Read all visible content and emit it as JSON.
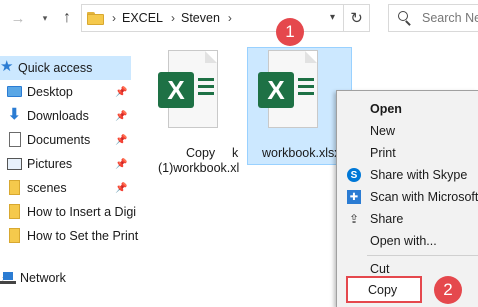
{
  "address_bar": {
    "crumbs": [
      "EXCEL",
      "Steven"
    ],
    "separator": "›",
    "search_placeholder": "Search Ne"
  },
  "nav_pane": {
    "items": [
      {
        "label": "Quick access",
        "icon": "star-icon",
        "pinned": false
      },
      {
        "label": "Desktop",
        "icon": "desktop-icon",
        "pinned": true
      },
      {
        "label": "Downloads",
        "icon": "download-icon",
        "pinned": true
      },
      {
        "label": "Documents",
        "icon": "documents-icon",
        "pinned": true
      },
      {
        "label": "Pictures",
        "icon": "pictures-icon",
        "pinned": true
      },
      {
        "label": "scenes",
        "icon": "folder-icon",
        "pinned": true
      },
      {
        "label": "How to Insert a Digi",
        "icon": "folder-icon",
        "pinned": false
      },
      {
        "label": "How to Set the Print",
        "icon": "folder-icon",
        "pinned": false
      },
      {
        "label": "Network",
        "icon": "network-icon",
        "pinned": false
      }
    ]
  },
  "files": [
    {
      "line1": "Copy",
      "line1_suffix": "k",
      "line2": "(1)workbook.xl",
      "selected": false
    },
    {
      "line1": "workbook.xlsx",
      "selected": true
    }
  ],
  "xl_letter": "X",
  "callouts": {
    "step1": "1",
    "step2": "2"
  },
  "context_menu": {
    "items": [
      {
        "label": "Open",
        "bold": true,
        "icon": ""
      },
      {
        "label": "New",
        "bold": false,
        "icon": ""
      },
      {
        "label": "Print",
        "bold": false,
        "icon": ""
      },
      {
        "label": "Share with Skype",
        "bold": false,
        "icon": "skype-icon"
      },
      {
        "label": "Scan with Microsoft",
        "bold": false,
        "icon": "defender-icon"
      },
      {
        "label": "Share",
        "bold": false,
        "icon": "share-icon"
      },
      {
        "label": "Open with...",
        "bold": false,
        "icon": ""
      },
      {
        "label": "Cut",
        "bold": false,
        "icon": ""
      },
      {
        "label": "Copy",
        "bold": false,
        "icon": ""
      }
    ]
  },
  "colors": {
    "excel_green": "#1e7145",
    "selection": "#cce8ff",
    "callout_red": "#e5484d",
    "folder": "#f5c94c"
  }
}
